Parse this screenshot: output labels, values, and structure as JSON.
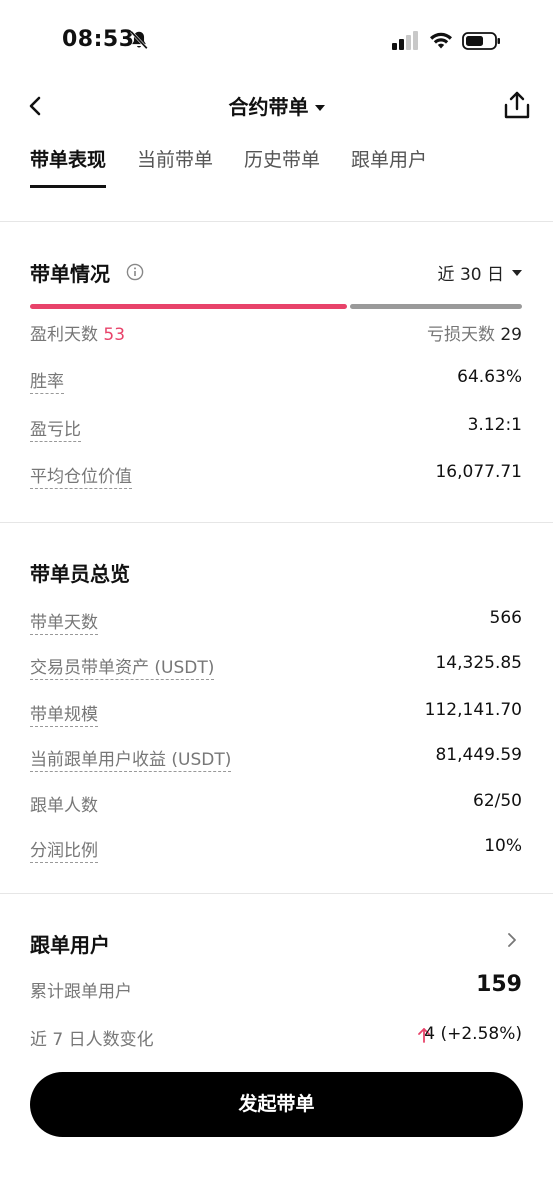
{
  "status_bar": {
    "time": "08:53",
    "icons": [
      "bell-off-icon",
      "signal-icon",
      "wifi-icon",
      "battery-icon"
    ]
  },
  "header": {
    "title": "合约带单",
    "icons": [
      "back-icon",
      "share-icon"
    ]
  },
  "tabs": [
    {
      "label": "带单表现",
      "active": true
    },
    {
      "label": "当前带单",
      "active": false
    },
    {
      "label": "历史带单",
      "active": false
    },
    {
      "label": "跟单用户",
      "active": false
    }
  ],
  "performance": {
    "title": "带单情况",
    "period": "近 30 日",
    "profit_days_label": "盈利天数",
    "profit_days": "53",
    "loss_days_label": "亏损天数",
    "loss_days": "29",
    "rows": [
      {
        "label": "胜率",
        "value": "64.63%"
      },
      {
        "label": "盈亏比",
        "value": "3.12:1"
      },
      {
        "label": "平均仓位价值",
        "value": "16,077.71"
      }
    ]
  },
  "overview": {
    "title": "带单员总览",
    "rows": [
      {
        "label": "带单天数",
        "value": "566"
      },
      {
        "label": "交易员带单资产 (USDT)",
        "value": "14,325.85"
      },
      {
        "label": "带单规模",
        "value": "112,141.70"
      },
      {
        "label": "当前跟单用户收益 (USDT)",
        "value": "81,449.59"
      },
      {
        "label": "跟单人数",
        "value": "62/50"
      },
      {
        "label": "分润比例",
        "value": "10%"
      }
    ]
  },
  "followers": {
    "title": "跟单用户",
    "total_label": "累计跟单用户",
    "total_value": "159",
    "change_label": "近 7 日人数变化",
    "change_value": "4 (+2.58%)"
  },
  "cta": {
    "label": "发起带单"
  },
  "colors": {
    "accent_red": "#e8436a",
    "loss_grey": "#9a9a9a",
    "button_black": "#000000"
  }
}
